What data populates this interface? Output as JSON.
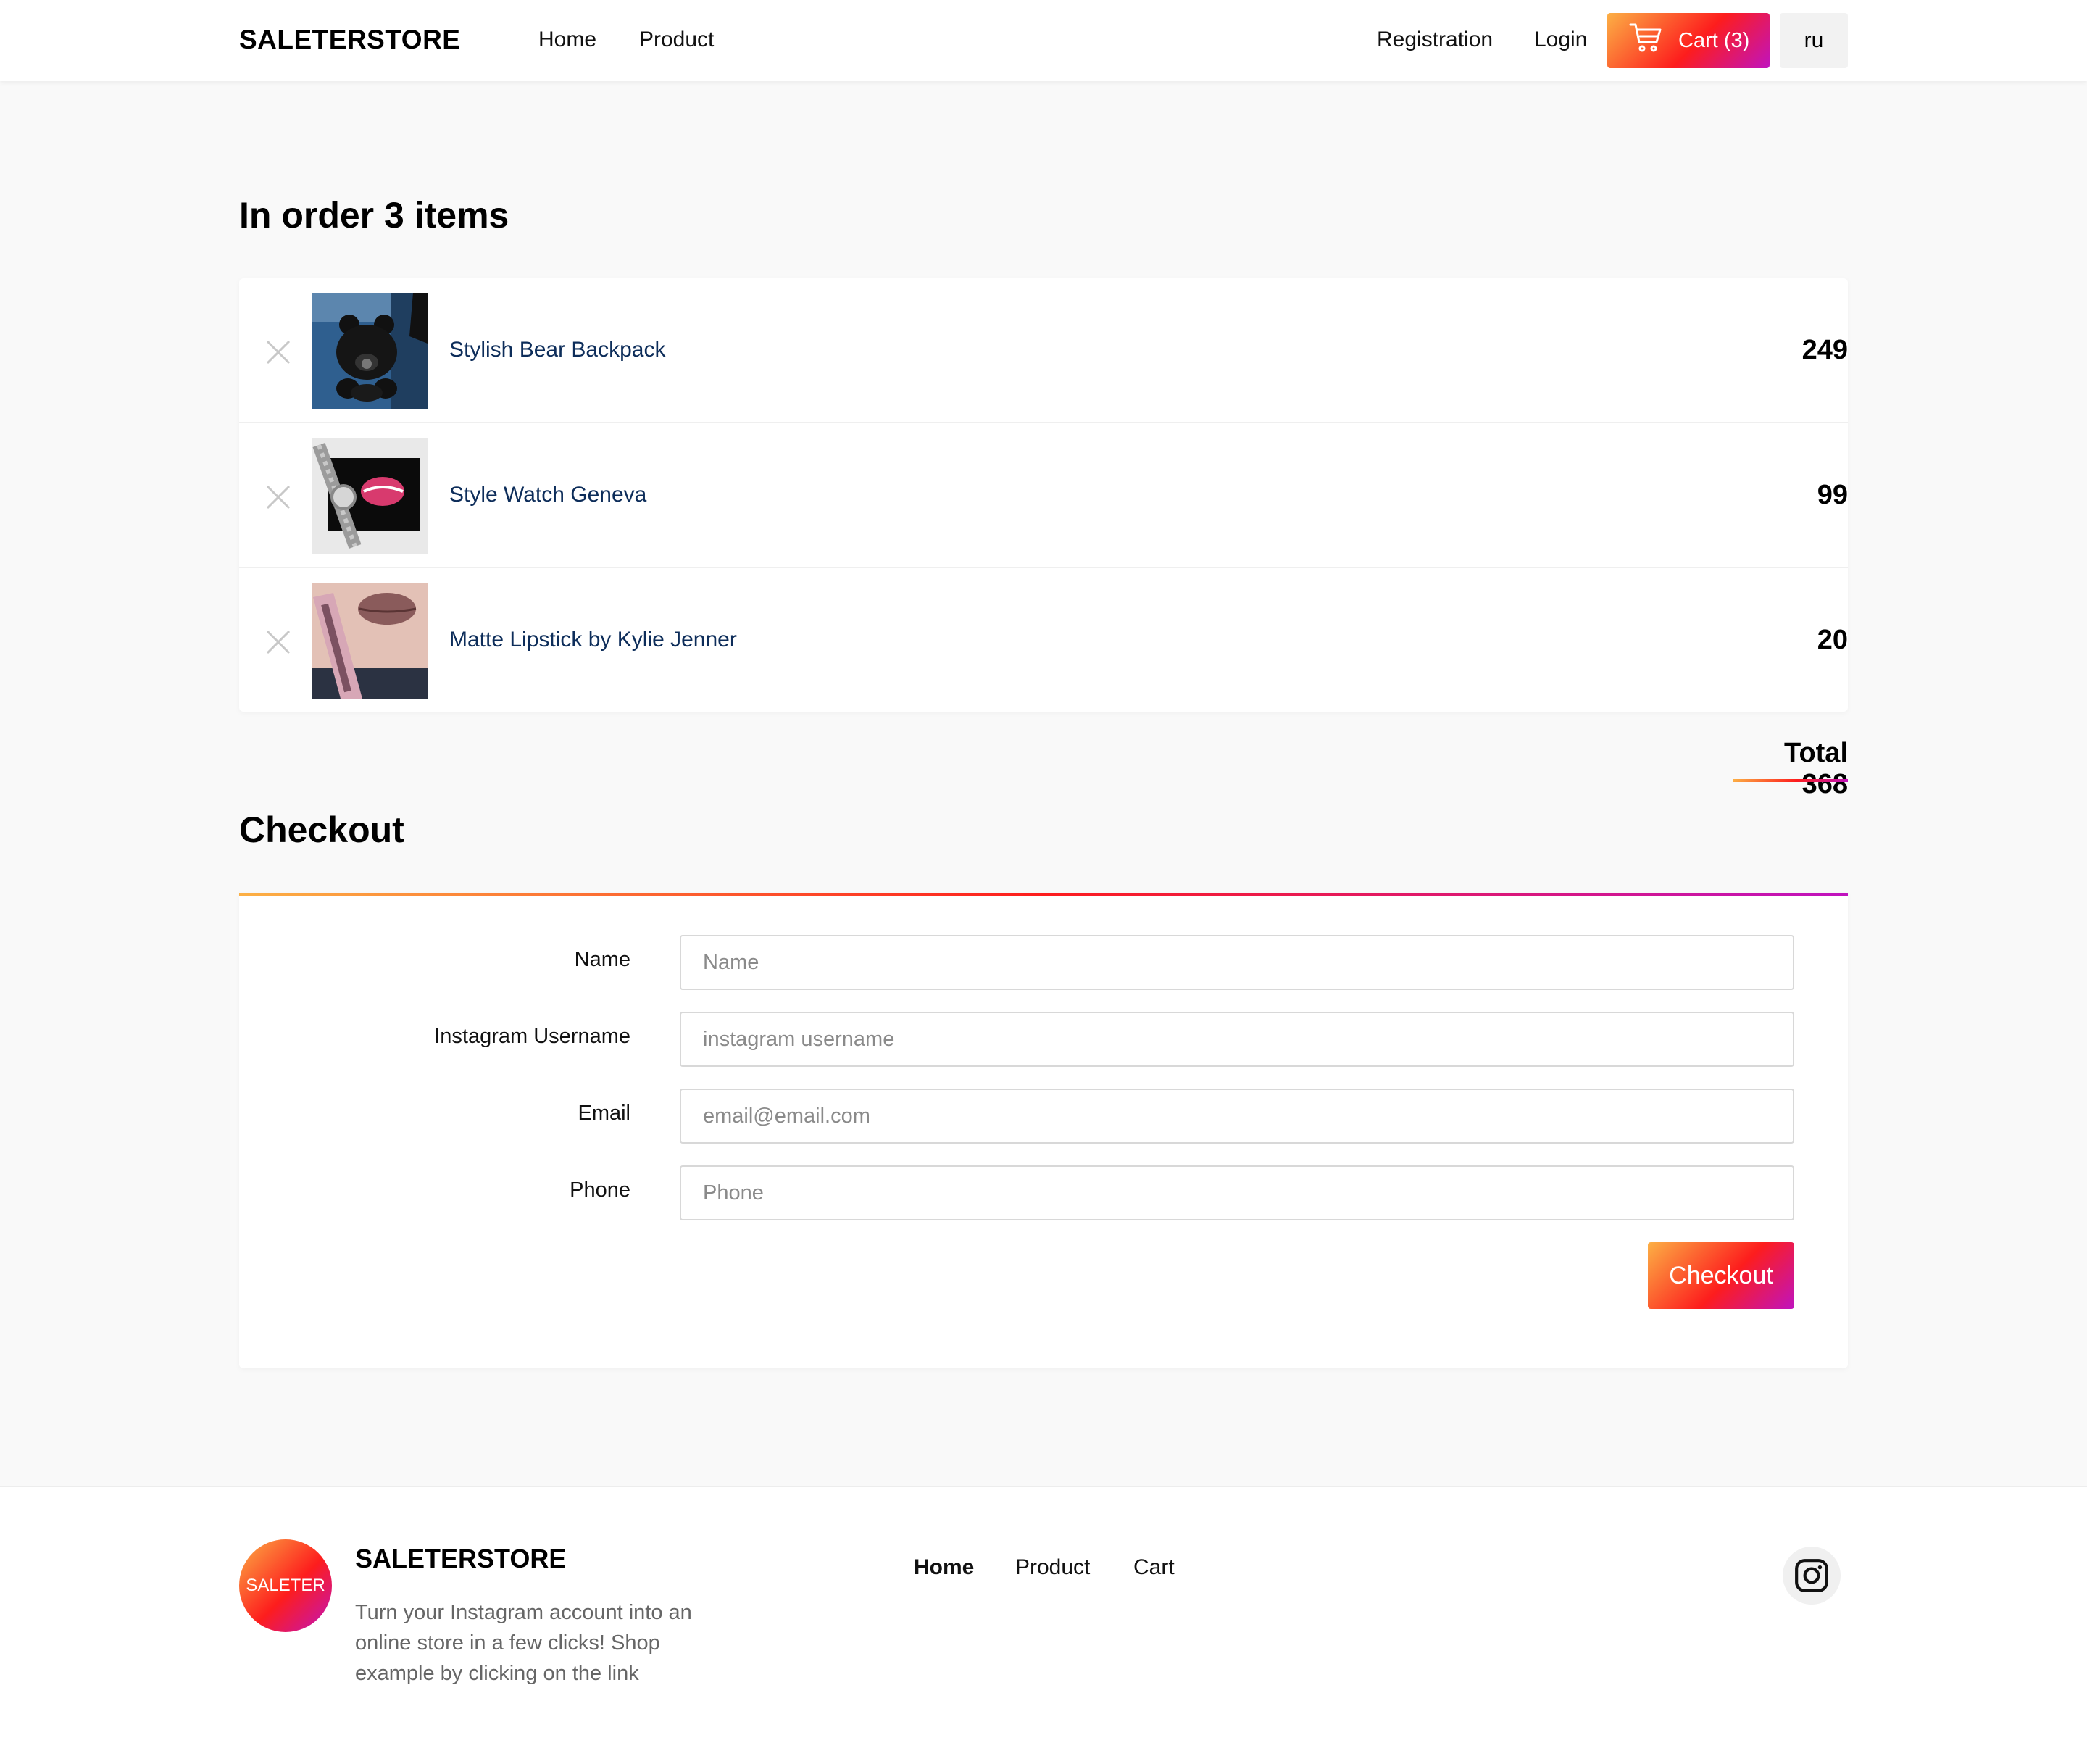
{
  "header": {
    "brand": "SALETERSTORE",
    "nav": [
      "Home",
      "Product"
    ],
    "registration": "Registration",
    "login": "Login",
    "cart_label": "Cart (3)",
    "lang": "ru"
  },
  "order": {
    "title": "In order 3 items",
    "items": [
      {
        "name": "Stylish Bear Backpack",
        "price": "249"
      },
      {
        "name": "Style Watch Geneva",
        "price": "99"
      },
      {
        "name": "Matte Lipstick by Kylie Jenner",
        "price": "20"
      }
    ],
    "total": "Total 368"
  },
  "checkout": {
    "title": "Checkout",
    "fields": [
      {
        "label": "Name",
        "placeholder": "Name",
        "value": ""
      },
      {
        "label": "Instagram Username",
        "placeholder": "instagram username",
        "value": ""
      },
      {
        "label": "Email",
        "placeholder": "email@email.com",
        "value": ""
      },
      {
        "label": "Phone",
        "placeholder": "Phone",
        "value": ""
      }
    ],
    "submit": "Checkout"
  },
  "footer": {
    "logo_text": "SALETER",
    "brand": "SALETERSTORE",
    "description": "Turn your Instagram account into an online store in a few clicks! Shop example by clicking on the link",
    "links": [
      "Home",
      "Product",
      "Cart"
    ]
  },
  "colors": {
    "gradient_start": "#fcb045",
    "gradient_mid": "#fd1d1d",
    "gradient_end": "#c013bf",
    "item_link": "#0d2d5a"
  },
  "icons": [
    "cart-icon",
    "close-icon",
    "instagram-icon"
  ]
}
